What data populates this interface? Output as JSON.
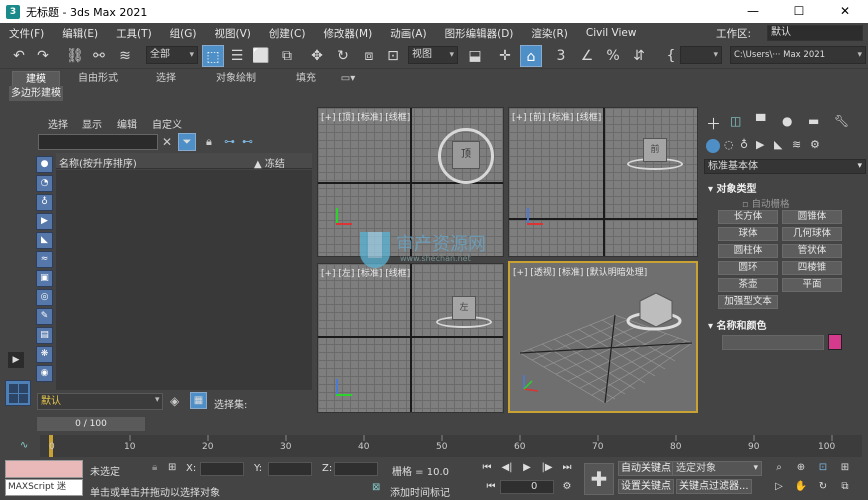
{
  "titlebar": {
    "title": "无标题 - 3ds Max 2021",
    "min": "—",
    "max": "☐",
    "close": "✕"
  },
  "menu": [
    "文件(F)",
    "编辑(E)",
    "工具(T)",
    "组(G)",
    "视图(V)",
    "创建(C)",
    "修改器(M)",
    "动画(A)",
    "图形编辑器(D)",
    "渲染(R)",
    "Civil View"
  ],
  "workspace": {
    "label": "工作区:",
    "value": "默认"
  },
  "toolbar": {
    "selection_filter": "全部",
    "ref_coord": "视图",
    "path_box": "C:\\Users\\··· Max 2021"
  },
  "ribbon": {
    "tabs": [
      "建模",
      "自由形式",
      "选择",
      "对象绘制",
      "填充"
    ],
    "active": 0,
    "subtab": "多边形建模"
  },
  "explorer": {
    "menus": [
      "选择",
      "显示",
      "编辑",
      "自定义"
    ],
    "col_name": "名称(按升序排序)",
    "col_freeze": "▲ 冻结",
    "layer": "默认",
    "selection_set_label": "选择集:"
  },
  "viewports": [
    {
      "label": "[+] [顶] [标准] [线框]",
      "cube_label": "顶"
    },
    {
      "label": "[+] [前] [标准] [线框]",
      "cube_label": "前"
    },
    {
      "label": "[+] [左] [标准] [线框]",
      "cube_label": "左"
    },
    {
      "label": "[+] [透视] [标准] [默认明暗处理]",
      "cube_label": ""
    }
  ],
  "watermark": {
    "text": "审产资源网",
    "sub": "www.shechan.net"
  },
  "cmdpanel": {
    "category": "标准基本体",
    "section_object_type": "对象类型",
    "autogrid": "自动栅格",
    "buttons": [
      "长方体",
      "圆锥体",
      "球体",
      "几何球体",
      "圆柱体",
      "管状体",
      "圆环",
      "四棱锥",
      "茶壶",
      "平面",
      "加强型文本"
    ],
    "section_name_color": "名称和颜色",
    "swatch_color": "#d63a8c"
  },
  "timeline": {
    "frame": "0 / 100",
    "ticks": [
      "0",
      "10",
      "20",
      "30",
      "40",
      "50",
      "60",
      "70",
      "80",
      "90",
      "100"
    ]
  },
  "status": {
    "maxscript": "MAXScript 迷",
    "selected": "未选定",
    "hint": "单击或单击并拖动以选择对象",
    "x_label": "X:",
    "y_label": "Y:",
    "z_label": "Z:",
    "grid": "栅格 = 10.0",
    "add_tag": "添加时间标记",
    "auto_key": "自动关键点",
    "set_key": "设置关键点",
    "selected_obj": "选定对象",
    "key_filter": "关键点过滤器...",
    "frame_field": "0"
  }
}
